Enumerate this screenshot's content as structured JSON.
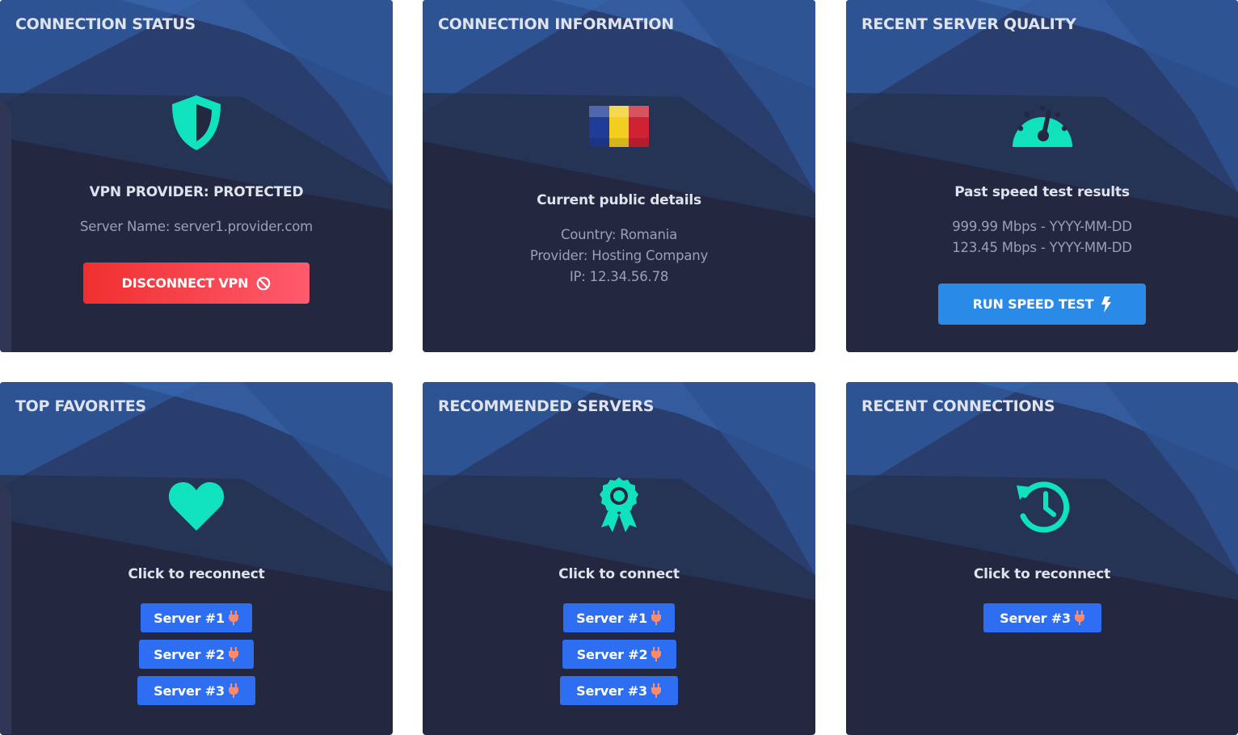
{
  "colors": {
    "card_bg": "#232840",
    "accent_teal": "#10e2bd",
    "disconnect_red": "#f0302f",
    "speed_blue": "#2a8ae8",
    "server_blue": "#2d6ef2",
    "plug_orange": "#ff8a6a"
  },
  "connection_status": {
    "title": "CONNECTION STATUS",
    "icon": "shield-icon",
    "status": "VPN PROVIDER: PROTECTED",
    "server_name": "Server Name: server1.provider.com",
    "disconnect_label": "DISCONNECT VPN"
  },
  "connection_info": {
    "title": "CONNECTION INFORMATION",
    "icon": "romania-flag-icon",
    "subhead": "Current public details",
    "country": "Country: Romania",
    "provider": "Provider: Hosting Company",
    "ip": "IP: 12.34.56.78"
  },
  "server_quality": {
    "title": "RECENT SERVER QUALITY",
    "icon": "speedometer-icon",
    "subhead": "Past speed test results",
    "results": [
      "999.99 Mbps - YYYY-MM-DD",
      "123.45 Mbps - YYYY-MM-DD"
    ],
    "run_label": "RUN SPEED TEST"
  },
  "top_favorites": {
    "title": "TOP FAVORITES",
    "icon": "heart-icon",
    "subhead": "Click to reconnect",
    "servers": [
      "Server #1",
      "Server #2",
      "Server #3"
    ]
  },
  "recommended_servers": {
    "title": "RECOMMENDED SERVERS",
    "icon": "award-icon",
    "subhead": "Click to connect",
    "servers": [
      "Server #1",
      "Server #2",
      "Server #3"
    ]
  },
  "recent_connections": {
    "title": "RECENT CONNECTIONS",
    "icon": "history-icon",
    "subhead": "Click to reconnect",
    "servers": [
      "Server #3"
    ]
  }
}
